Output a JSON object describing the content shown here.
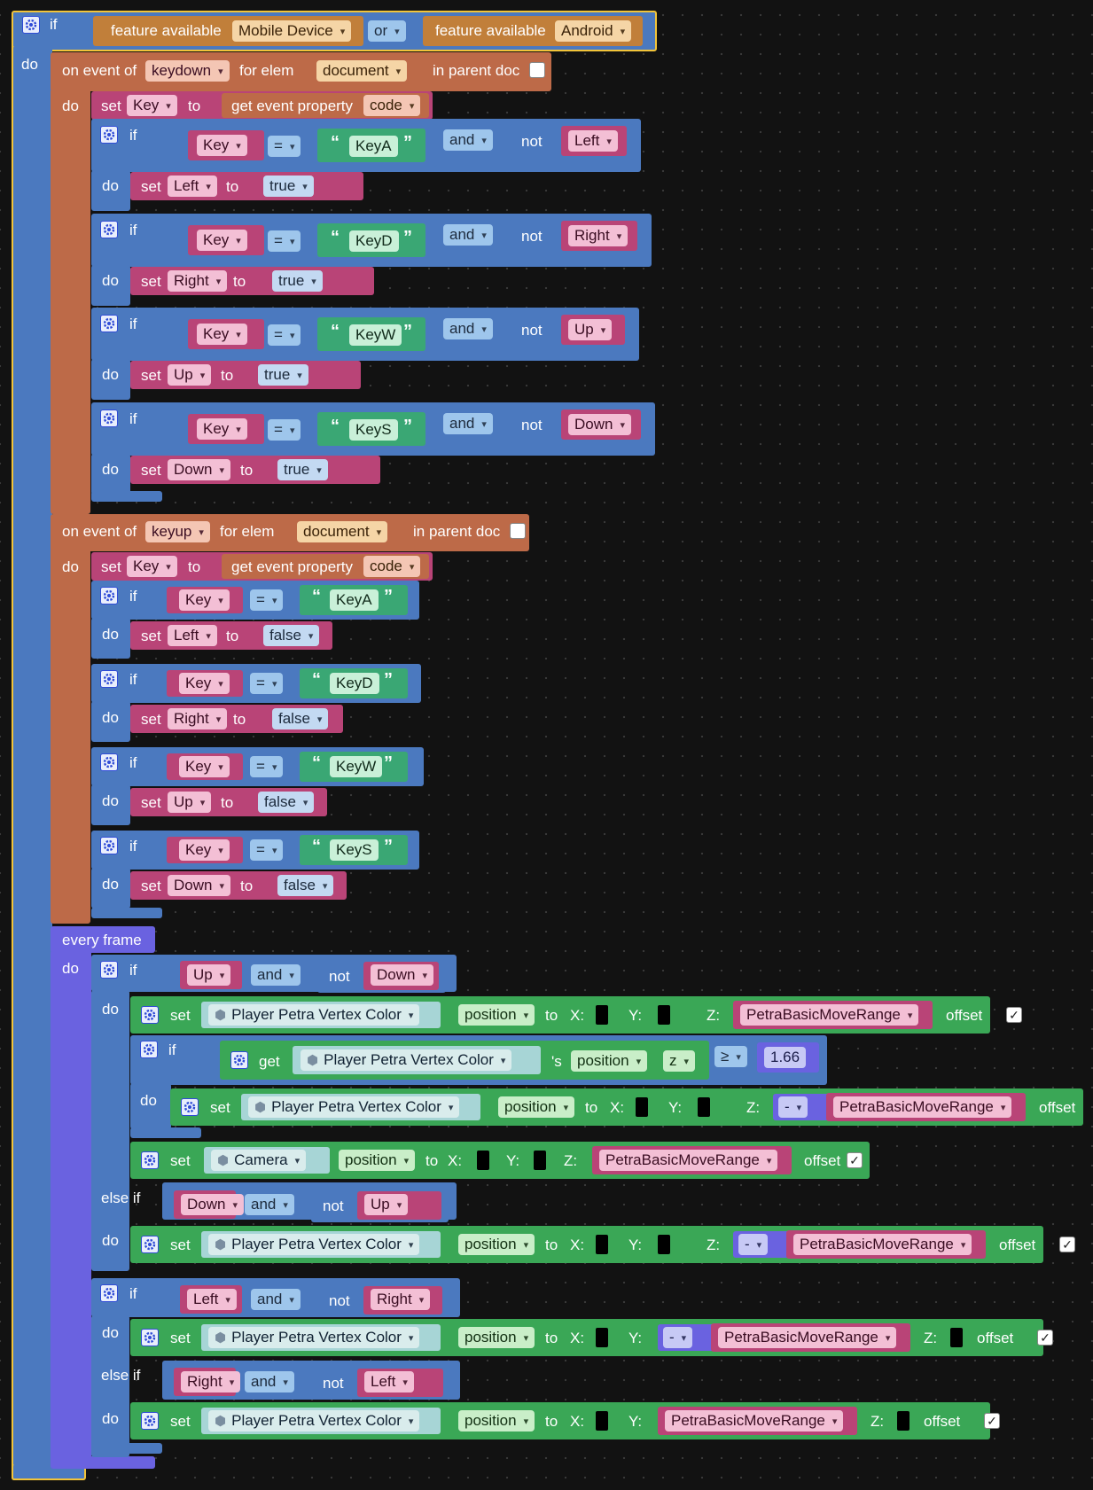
{
  "colors": {
    "logic": "#4b79bf",
    "event": "#bd6a48",
    "var": "#b94477",
    "text": "#3aa774",
    "feature": "#c17f3a",
    "frame": "#6a62e0",
    "object": "#3aa756",
    "highlight": "#f2c439"
  },
  "kw": {
    "if": "if",
    "do": "do",
    "else_if": "else if",
    "set": "set",
    "to": "to",
    "and": "and",
    "or": "or",
    "not": "not",
    "eq": "=",
    "gte": "≥",
    "minus": "-",
    "get": "get",
    "offset": "offset",
    "x": "X:",
    "y": "Y:",
    "z": "Z:",
    "true": "true",
    "false": "false",
    "poss": "'s",
    "open_q": "“",
    "close_q": "”",
    "check": "✓"
  },
  "top_if": {
    "cond_a_label": "feature available",
    "cond_a_value": "Mobile Device",
    "op": "or",
    "cond_b_label": "feature available",
    "cond_b_value": "Android"
  },
  "events": [
    {
      "label": "on event of",
      "event": "keydown",
      "for_elem": "for elem",
      "elem": "document",
      "parent": "in parent doc",
      "set_var": "Key",
      "get_prop": "get event property",
      "prop": "code"
    },
    {
      "label": "on event of",
      "event": "keyup",
      "for_elem": "for elem",
      "elem": "document",
      "parent": "in parent doc",
      "set_var": "Key",
      "get_prop": "get event property",
      "prop": "code"
    }
  ],
  "keydown_rules": [
    {
      "var": "Key",
      "str": "KeyA",
      "not_var": "Left",
      "set_var": "Left",
      "value": "true"
    },
    {
      "var": "Key",
      "str": "KeyD",
      "not_var": "Right",
      "set_var": "Right",
      "value": "true"
    },
    {
      "var": "Key",
      "str": "KeyW",
      "not_var": "Up",
      "set_var": "Up",
      "value": "true"
    },
    {
      "var": "Key",
      "str": "KeyS",
      "not_var": "Down",
      "set_var": "Down",
      "value": "true"
    }
  ],
  "keyup_rules": [
    {
      "var": "Key",
      "str": "KeyA",
      "set_var": "Left",
      "value": "false"
    },
    {
      "var": "Key",
      "str": "KeyD",
      "set_var": "Right",
      "value": "false"
    },
    {
      "var": "Key",
      "str": "KeyW",
      "set_var": "Up",
      "value": "false"
    },
    {
      "var": "Key",
      "str": "KeyS",
      "set_var": "Down",
      "value": "false"
    }
  ],
  "every_frame": {
    "label": "every frame",
    "if1": {
      "a": "Up",
      "b": "Down"
    },
    "set_player_z": {
      "object": "Player Petra Vertex Color",
      "prop": "position",
      "range": "PetraBasicMoveRange"
    },
    "inner_if": {
      "object": "Player Petra Vertex Color",
      "prop": "position",
      "axis": "z",
      "threshold": "1.66"
    },
    "inner_set": {
      "object": "Player Petra Vertex Color",
      "prop": "position",
      "range": "PetraBasicMoveRange"
    },
    "camera_set": {
      "object": "Camera",
      "prop": "position",
      "range": "PetraBasicMoveRange"
    },
    "elseif1": {
      "a": "Down",
      "b": "Up"
    },
    "set_player_negz": {
      "object": "Player Petra Vertex Color",
      "prop": "position",
      "range": "PetraBasicMoveRange"
    },
    "if2": {
      "a": "Left",
      "b": "Right"
    },
    "set_player_negy": {
      "object": "Player Petra Vertex Color",
      "prop": "position",
      "range": "PetraBasicMoveRange"
    },
    "elseif2": {
      "a": "Right",
      "b": "Left"
    },
    "set_player_y": {
      "object": "Player Petra Vertex Color",
      "prop": "position",
      "range": "PetraBasicMoveRange"
    }
  }
}
